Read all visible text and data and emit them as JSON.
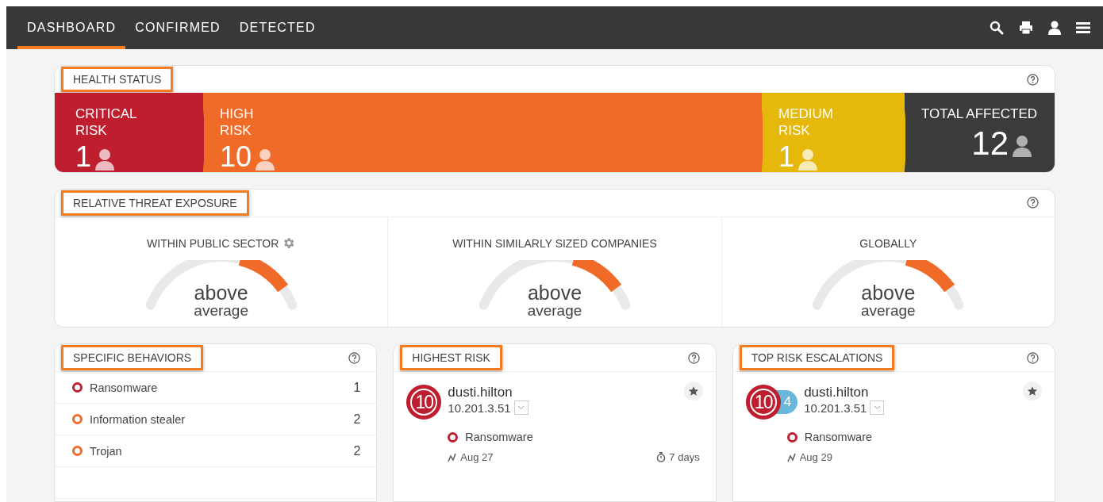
{
  "nav": {
    "tabs": [
      {
        "label": "DASHBOARD",
        "selected": true
      },
      {
        "label": "CONFIRMED",
        "selected": false
      },
      {
        "label": "DETECTED",
        "selected": false
      }
    ]
  },
  "health_status": {
    "title": "HEALTH STATUS",
    "segments": [
      {
        "kind": "risk",
        "label": "CRITICAL RISK",
        "count": "1",
        "color": "#be1e2d"
      },
      {
        "kind": "risk",
        "label": "HIGH RISK",
        "count": "10",
        "color": "#f06a28"
      },
      {
        "kind": "risk",
        "label": "MEDIUM RISK",
        "count": "1",
        "color": "#e5b80b"
      },
      {
        "kind": "total",
        "label": "TOTAL AFFECTED",
        "count": "12",
        "color": "#3b3b3b"
      }
    ]
  },
  "threat_exposure": {
    "title": "RELATIVE THREAT EXPOSURE",
    "gauges": [
      {
        "label": "WITHIN PUBLIC SECTOR",
        "settings": true,
        "value": "above",
        "caption": "average"
      },
      {
        "label": "WITHIN SIMILARLY SIZED COMPANIES",
        "settings": false,
        "value": "above",
        "caption": "average"
      },
      {
        "label": "GLOBALLY",
        "settings": false,
        "value": "above",
        "caption": "average"
      }
    ]
  },
  "specific_behaviors": {
    "title": "SPECIFIC BEHAVIORS",
    "items": [
      {
        "name": "Ransomware",
        "count": "1",
        "color": "#be1e2d"
      },
      {
        "name": "Information stealer",
        "count": "2",
        "color": "#f06a28"
      },
      {
        "name": "Trojan",
        "count": "2",
        "color": "#f06a28"
      }
    ]
  },
  "highest_risk": {
    "title": "HIGHEST RISK",
    "entries": [
      {
        "score": "10",
        "user": "dusti.hilton",
        "ip": "10.201.3.51",
        "behavior": {
          "name": "Ransomware",
          "color": "#be1e2d"
        },
        "date": "Aug 27",
        "duration": "7 days"
      }
    ]
  },
  "top_risk_escalations": {
    "title": "TOP RISK ESCALATIONS",
    "entries": [
      {
        "score": "10",
        "escalation": "4",
        "user": "dusti.hilton",
        "ip": "10.201.3.51",
        "behavior": {
          "name": "Ransomware",
          "color": "#be1e2d"
        },
        "date": "Aug 29"
      }
    ]
  }
}
